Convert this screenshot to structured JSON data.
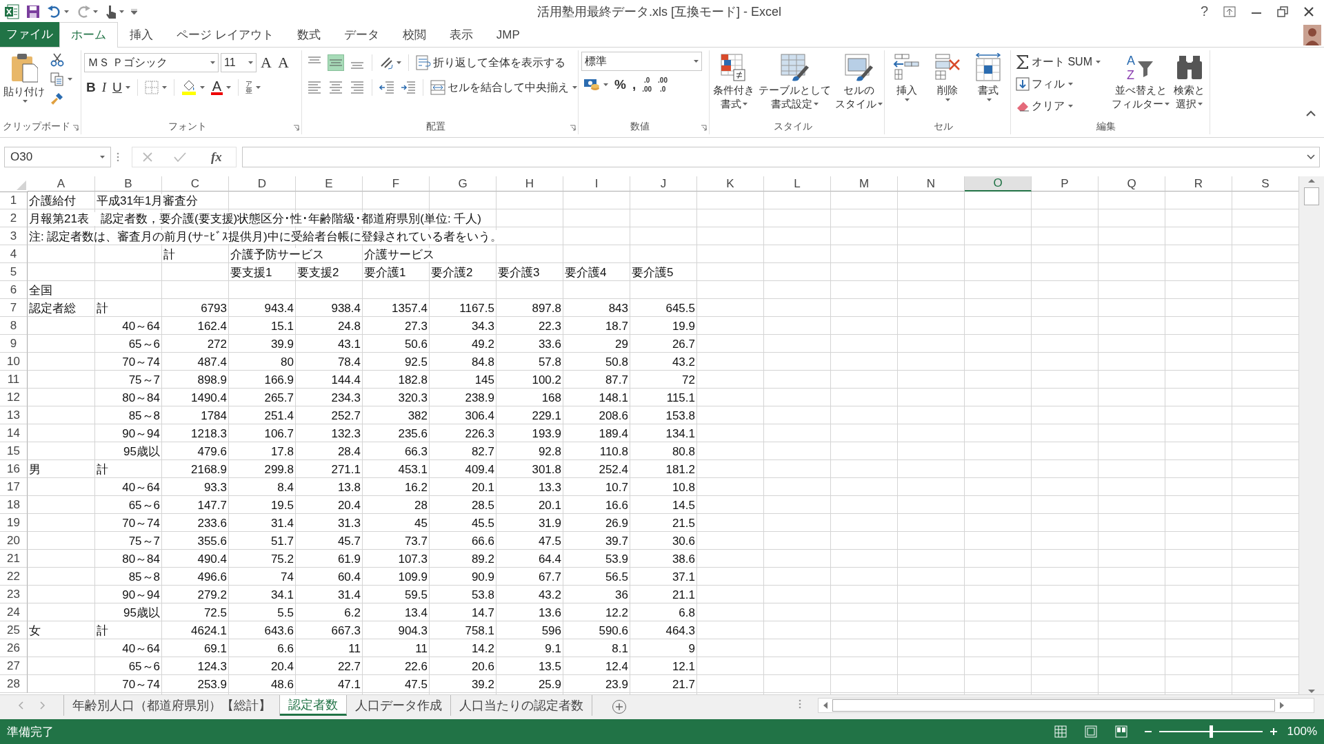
{
  "window": {
    "title": "活用塾用最終データ.xls [互換モード] - Excel",
    "help": "?"
  },
  "ribbon_tabs": [
    {
      "label": "ファイル",
      "kind": "file",
      "selected": false
    },
    {
      "label": "ホーム",
      "kind": "tab",
      "selected": true
    },
    {
      "label": "挿入",
      "kind": "tab",
      "selected": false
    },
    {
      "label": "ページ レイアウト",
      "kind": "tab",
      "selected": false
    },
    {
      "label": "数式",
      "kind": "tab",
      "selected": false
    },
    {
      "label": "データ",
      "kind": "tab",
      "selected": false
    },
    {
      "label": "校閲",
      "kind": "tab",
      "selected": false
    },
    {
      "label": "表示",
      "kind": "tab",
      "selected": false
    },
    {
      "label": "JMP",
      "kind": "tab",
      "selected": false
    }
  ],
  "ribbon": {
    "clipboard": {
      "label": "クリップボード",
      "paste": "貼り付け"
    },
    "font": {
      "label": "フォント",
      "font_name": "ＭＳ Ｐゴシック",
      "font_size": "11",
      "grow": "A",
      "shrink": "A",
      "bold": "B",
      "italic": "I",
      "underline": "U",
      "font_color": "A",
      "phonetic": [
        "ア",
        "亜"
      ]
    },
    "alignment": {
      "label": "配置",
      "vertical_align": [
        {
          "selected": false
        },
        {
          "selected": true
        },
        {
          "selected": false
        }
      ],
      "wrap": "折り返して全体を表示する",
      "merge": "セルを結合して中央揃え"
    },
    "number": {
      "label": "数値",
      "format": "標準",
      "percent": "%",
      "comma": ",",
      "decimal_buttons": [
        [
          ".0",
          ".00"
        ],
        [
          ".00",
          ".0"
        ]
      ]
    },
    "styles": {
      "label": "スタイル",
      "buttons": [
        [
          "条件付き",
          "書式"
        ],
        [
          "テーブルとして",
          "書式設定"
        ],
        [
          "セルの",
          "スタイル"
        ]
      ]
    },
    "cells": {
      "label": "セル",
      "buttons": [
        "挿入",
        "削除",
        "書式"
      ]
    },
    "editing": {
      "label": "編集",
      "autosum": "オート SUM",
      "fill": "フィル",
      "clear": "クリア",
      "sort_letters": [
        "A",
        "Z"
      ],
      "sort": [
        "並べ替えと",
        "フィルター"
      ],
      "find": [
        "検索と",
        "選択"
      ]
    }
  },
  "formula_bar": {
    "name_box": "O30",
    "fx": "fx"
  },
  "sheet": {
    "columns": [
      {
        "label": "A",
        "selected": false
      },
      {
        "label": "B",
        "selected": false
      },
      {
        "label": "C",
        "selected": false
      },
      {
        "label": "D",
        "selected": false
      },
      {
        "label": "E",
        "selected": false
      },
      {
        "label": "F",
        "selected": false
      },
      {
        "label": "G",
        "selected": false
      },
      {
        "label": "H",
        "selected": false
      },
      {
        "label": "I",
        "selected": false
      },
      {
        "label": "J",
        "selected": false
      },
      {
        "label": "K",
        "selected": false
      },
      {
        "label": "L",
        "selected": false
      },
      {
        "label": "M",
        "selected": false
      },
      {
        "label": "N",
        "selected": false
      },
      {
        "label": "O",
        "selected": true
      },
      {
        "label": "P",
        "selected": false
      },
      {
        "label": "Q",
        "selected": false
      },
      {
        "label": "R",
        "selected": false
      },
      {
        "label": "S",
        "selected": false
      }
    ],
    "rows": [
      {
        "number": "1",
        "kind": "title",
        "cells": {
          "A": "介護給付",
          "B": "平成31年1月審査分"
        }
      },
      {
        "number": "2",
        "kind": "title",
        "cells": {
          "A": "月報第21表　認定者数，要介護(要支援)状態区分･性･年齢階級･都道府県別(単位: 千人)"
        }
      },
      {
        "number": "3",
        "kind": "title",
        "cells": {
          "A": "注: 認定者数は、審査月の前月(サｰﾋﾞｽ提供月)中に受給者台帳に登録されている者をいう。"
        }
      },
      {
        "number": "4",
        "kind": "title",
        "cells": {
          "C": "計",
          "D": "介護予防サービス",
          "F": "介護サービス"
        }
      },
      {
        "number": "5",
        "kind": "title",
        "cells": {
          "D": "要支援1",
          "E": "要支援2",
          "F": "要介護1",
          "G": "要介護2",
          "H": "要介護3",
          "I": "要介護4",
          "J": "要介護5"
        }
      },
      {
        "number": "6",
        "kind": "title",
        "cells": {
          "A": "全国"
        }
      },
      {
        "number": "7",
        "kind": "total",
        "cells": {
          "A": "認定者総",
          "B": "計",
          "C": "6793",
          "D": "943.4",
          "E": "938.4",
          "F": "1357.4",
          "G": "1167.5",
          "H": "897.8",
          "I": "843",
          "J": "645.5"
        }
      },
      {
        "number": "8",
        "kind": "age",
        "cells": {
          "B": "40～64",
          "C": "162.4",
          "D": "15.1",
          "E": "24.8",
          "F": "27.3",
          "G": "34.3",
          "H": "22.3",
          "I": "18.7",
          "J": "19.9"
        }
      },
      {
        "number": "9",
        "kind": "age",
        "cells": {
          "B": "65～6",
          "C": "272",
          "D": "39.9",
          "E": "43.1",
          "F": "50.6",
          "G": "49.2",
          "H": "33.6",
          "I": "29",
          "J": "26.7"
        }
      },
      {
        "number": "10",
        "kind": "age",
        "cells": {
          "B": "70～74",
          "C": "487.4",
          "D": "80",
          "E": "78.4",
          "F": "92.5",
          "G": "84.8",
          "H": "57.8",
          "I": "50.8",
          "J": "43.2"
        }
      },
      {
        "number": "11",
        "kind": "age",
        "cells": {
          "B": "75～7",
          "C": "898.9",
          "D": "166.9",
          "E": "144.4",
          "F": "182.8",
          "G": "145",
          "H": "100.2",
          "I": "87.7",
          "J": "72"
        }
      },
      {
        "number": "12",
        "kind": "age",
        "cells": {
          "B": "80～84",
          "C": "1490.4",
          "D": "265.7",
          "E": "234.3",
          "F": "320.3",
          "G": "238.9",
          "H": "168",
          "I": "148.1",
          "J": "115.1"
        }
      },
      {
        "number": "13",
        "kind": "age",
        "cells": {
          "B": "85～8",
          "C": "1784",
          "D": "251.4",
          "E": "252.7",
          "F": "382",
          "G": "306.4",
          "H": "229.1",
          "I": "208.6",
          "J": "153.8"
        }
      },
      {
        "number": "14",
        "kind": "age",
        "cells": {
          "B": "90～94",
          "C": "1218.3",
          "D": "106.7",
          "E": "132.3",
          "F": "235.6",
          "G": "226.3",
          "H": "193.9",
          "I": "189.4",
          "J": "134.1"
        }
      },
      {
        "number": "15",
        "kind": "age",
        "cells": {
          "B": "95歳以",
          "C": "479.6",
          "D": "17.8",
          "E": "28.4",
          "F": "66.3",
          "G": "82.7",
          "H": "92.8",
          "I": "110.8",
          "J": "80.8"
        }
      },
      {
        "number": "16",
        "kind": "total",
        "cells": {
          "A": "男",
          "B": "計",
          "C": "2168.9",
          "D": "299.8",
          "E": "271.1",
          "F": "453.1",
          "G": "409.4",
          "H": "301.8",
          "I": "252.4",
          "J": "181.2"
        }
      },
      {
        "number": "17",
        "kind": "age",
        "cells": {
          "B": "40～64",
          "C": "93.3",
          "D": "8.4",
          "E": "13.8",
          "F": "16.2",
          "G": "20.1",
          "H": "13.3",
          "I": "10.7",
          "J": "10.8"
        }
      },
      {
        "number": "18",
        "kind": "age",
        "cells": {
          "B": "65～6",
          "C": "147.7",
          "D": "19.5",
          "E": "20.4",
          "F": "28",
          "G": "28.5",
          "H": "20.1",
          "I": "16.6",
          "J": "14.5"
        }
      },
      {
        "number": "19",
        "kind": "age",
        "cells": {
          "B": "70～74",
          "C": "233.6",
          "D": "31.4",
          "E": "31.3",
          "F": "45",
          "G": "45.5",
          "H": "31.9",
          "I": "26.9",
          "J": "21.5"
        }
      },
      {
        "number": "20",
        "kind": "age",
        "cells": {
          "B": "75～7",
          "C": "355.6",
          "D": "51.7",
          "E": "45.7",
          "F": "73.7",
          "G": "66.6",
          "H": "47.5",
          "I": "39.7",
          "J": "30.6"
        }
      },
      {
        "number": "21",
        "kind": "age",
        "cells": {
          "B": "80～84",
          "C": "490.4",
          "D": "75.2",
          "E": "61.9",
          "F": "107.3",
          "G": "89.2",
          "H": "64.4",
          "I": "53.9",
          "J": "38.6"
        }
      },
      {
        "number": "22",
        "kind": "age",
        "cells": {
          "B": "85～8",
          "C": "496.6",
          "D": "74",
          "E": "60.4",
          "F": "109.9",
          "G": "90.9",
          "H": "67.7",
          "I": "56.5",
          "J": "37.1"
        }
      },
      {
        "number": "23",
        "kind": "age",
        "cells": {
          "B": "90～94",
          "C": "279.2",
          "D": "34.1",
          "E": "31.4",
          "F": "59.5",
          "G": "53.8",
          "H": "43.2",
          "I": "36",
          "J": "21.1"
        }
      },
      {
        "number": "24",
        "kind": "age",
        "cells": {
          "B": "95歳以",
          "C": "72.5",
          "D": "5.5",
          "E": "6.2",
          "F": "13.4",
          "G": "14.7",
          "H": "13.6",
          "I": "12.2",
          "J": "6.8"
        }
      },
      {
        "number": "25",
        "kind": "total",
        "cells": {
          "A": "女",
          "B": "計",
          "C": "4624.1",
          "D": "643.6",
          "E": "667.3",
          "F": "904.3",
          "G": "758.1",
          "H": "596",
          "I": "590.6",
          "J": "464.3"
        }
      },
      {
        "number": "26",
        "kind": "age",
        "cells": {
          "B": "40～64",
          "C": "69.1",
          "D": "6.6",
          "E": "11",
          "F": "11",
          "G": "14.2",
          "H": "9.1",
          "I": "8.1",
          "J": "9"
        }
      },
      {
        "number": "27",
        "kind": "age",
        "cells": {
          "B": "65～6",
          "C": "124.3",
          "D": "20.4",
          "E": "22.7",
          "F": "22.6",
          "G": "20.6",
          "H": "13.5",
          "I": "12.4",
          "J": "12.1"
        }
      },
      {
        "number": "28",
        "kind": "age",
        "cells": {
          "B": "70～74",
          "C": "253.9",
          "D": "48.6",
          "E": "47.1",
          "F": "47.5",
          "G": "39.2",
          "H": "25.9",
          "I": "23.9",
          "J": "21.7"
        }
      }
    ]
  },
  "sheet_tabs": [
    {
      "label": "年齢別人口（都道府県別）【総計】",
      "selected": false
    },
    {
      "label": "認定者数",
      "selected": true
    },
    {
      "label": "人口データ作成",
      "selected": false
    },
    {
      "label": "人口当たりの認定者数",
      "selected": false
    }
  ],
  "status_bar": {
    "status": "準備完了",
    "zoom": "100%",
    "zoom_slider": {
      "level": 0.5
    }
  }
}
